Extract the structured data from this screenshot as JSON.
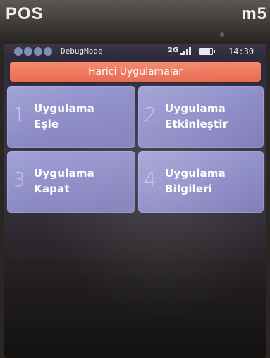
{
  "device": {
    "brand_left": "POS",
    "brand_right": "m5"
  },
  "statusbar": {
    "mode": "DebugMode",
    "network": "2G",
    "time": "14:30",
    "signal_icon": "signal-bars-icon",
    "battery_icon": "battery-icon"
  },
  "app": {
    "title": "Harici Uygulamalar"
  },
  "menu": {
    "items": [
      {
        "number": "1",
        "line1": "Uygulama",
        "line2": "Eşle"
      },
      {
        "number": "2",
        "line1": "Uygulama",
        "line2": "Etkinleştir"
      },
      {
        "number": "3",
        "line1": "Uygulama",
        "line2": "Kapat"
      },
      {
        "number": "4",
        "line1": "Uygulama",
        "line2": "Bilgileri"
      }
    ]
  },
  "colors": {
    "title_bar": "#e86a52",
    "tile": "#8d8bc6",
    "status_dots": "#7f8fb8"
  }
}
